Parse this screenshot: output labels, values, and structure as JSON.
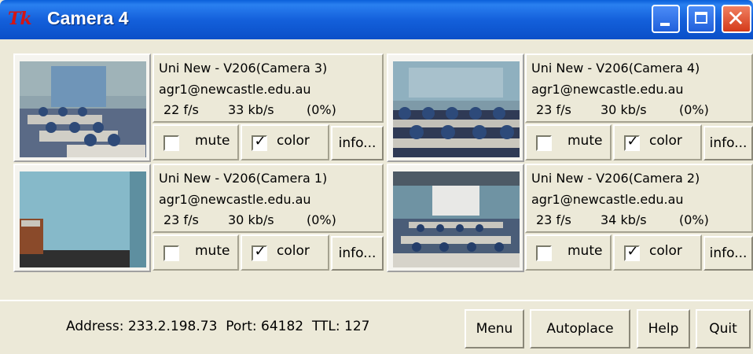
{
  "window": {
    "title": "Camera 4",
    "logo": "Tk"
  },
  "titlebar_buttons": {
    "minimize": "minimize-icon",
    "maximize": "maximize-icon",
    "close": "close-icon",
    "close_glyph": "✕"
  },
  "panels": [
    {
      "title": "Uni New - V206(Camera 3)",
      "email": "agr1@newcastle.edu.au",
      "fps": "22 f/s",
      "kbps": "33 kb/s",
      "loss": "(0%)",
      "mute_label": "mute",
      "mute_checked": false,
      "color_label": "color",
      "color_checked": true,
      "info_label": "info..."
    },
    {
      "title": "Uni New - V206(Camera 4)",
      "email": "agr1@newcastle.edu.au",
      "fps": "23 f/s",
      "kbps": "30 kb/s",
      "loss": "(0%)",
      "mute_label": "mute",
      "mute_checked": false,
      "color_label": "color",
      "color_checked": true,
      "info_label": "info..."
    },
    {
      "title": "Uni New - V206(Camera 1)",
      "email": "agr1@newcastle.edu.au",
      "fps": "23 f/s",
      "kbps": "30 kb/s",
      "loss": "(0%)",
      "mute_label": "mute",
      "mute_checked": false,
      "color_label": "color",
      "color_checked": true,
      "info_label": "info..."
    },
    {
      "title": "Uni New - V206(Camera 2)",
      "email": "agr1@newcastle.edu.au",
      "fps": "23 f/s",
      "kbps": "34 kb/s",
      "loss": "(0%)",
      "mute_label": "mute",
      "mute_checked": false,
      "color_label": "color",
      "color_checked": true,
      "info_label": "info..."
    }
  ],
  "status": {
    "address_label": "Address: 233.2.198.73",
    "port_label": "Port: 64182",
    "ttl_label": "TTL: 127"
  },
  "buttons": {
    "menu": "Menu",
    "autoplace": "Autoplace",
    "help": "Help",
    "quit": "Quit"
  },
  "colors": {
    "titlebar": "#0a5fd9",
    "window_bg": "#ece9d8",
    "close_button": "#d43a1a"
  }
}
